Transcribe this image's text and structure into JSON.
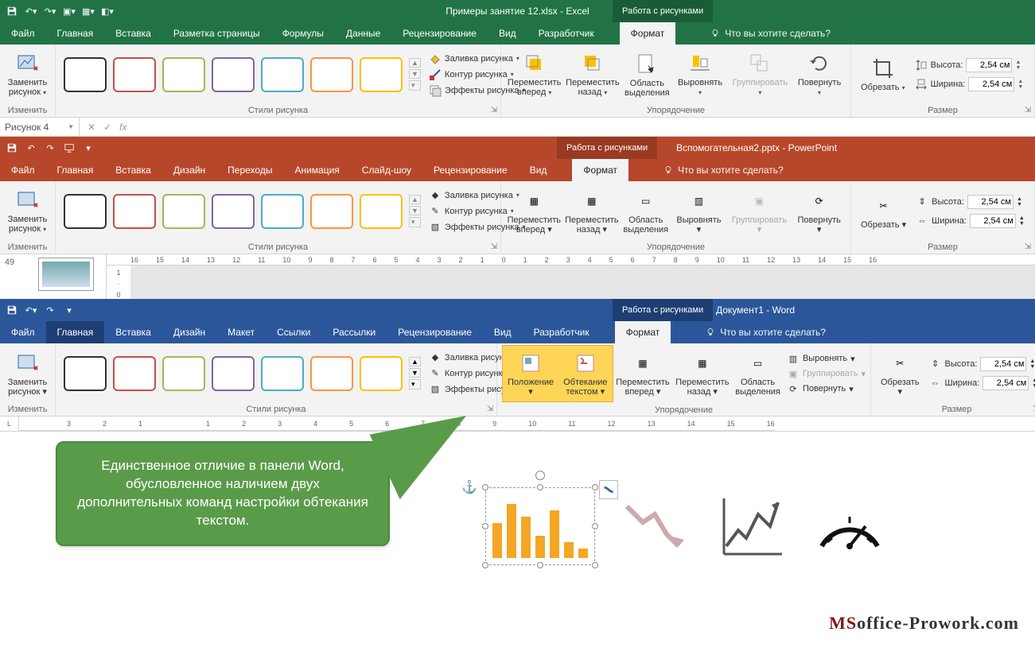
{
  "colors": {
    "excel": "#217346",
    "ppt": "#b7472a",
    "word": "#2b579a",
    "wordAccent": "#1e3e73"
  },
  "qat": {
    "save": "save-icon",
    "undo": "undo-icon",
    "redo": "redo-icon"
  },
  "excel": {
    "title": "Примеры занятие 12.xlsx  -  Excel",
    "ctxHeader": "Работа с рисунками",
    "tabs": [
      "Файл",
      "Главная",
      "Вставка",
      "Разметка страницы",
      "Формулы",
      "Данные",
      "Рецензирование",
      "Вид",
      "Разработчик"
    ],
    "activeTab": "Формат",
    "tellMe": "Что вы хотите сделать?",
    "nameBox": "Рисунок 4"
  },
  "ppt": {
    "title": "Вспомогательная2.pptx  -  PowerPoint",
    "ctxHeader": "Работа с рисунками",
    "tabs": [
      "Файл",
      "Главная",
      "Вставка",
      "Дизайн",
      "Переходы",
      "Анимация",
      "Слайд-шоу",
      "Рецензирование",
      "Вид"
    ],
    "activeTab": "Формат",
    "tellMe": "Что вы хотите сделать?",
    "slideNum": "49",
    "rulerTicks": [
      "16",
      "15",
      "14",
      "13",
      "12",
      "11",
      "10",
      "9",
      "8",
      "7",
      "6",
      "5",
      "4",
      "3",
      "2",
      "1",
      "0",
      "1",
      "2",
      "3",
      "4",
      "5",
      "6",
      "7",
      "8",
      "9",
      "10",
      "11",
      "12",
      "13",
      "14",
      "15",
      "16"
    ]
  },
  "word": {
    "title": "Документ1  -  Word",
    "ctxHeader": "Работа с рисунками",
    "tabs": [
      "Файл",
      "Главная",
      "Вставка",
      "Дизайн",
      "Макет",
      "Ссылки",
      "Рассылки",
      "Рецензирование",
      "Вид",
      "Разработчик"
    ],
    "activeTab": "Формат",
    "tellMe": "Что вы хотите сделать?",
    "rulerTicks": [
      "3",
      "2",
      "1",
      "",
      "1",
      "2",
      "3",
      "4",
      "5",
      "6",
      "7",
      "8",
      "9",
      "10",
      "11",
      "12",
      "13",
      "14",
      "15",
      "16"
    ]
  },
  "ribbonCommon": {
    "changeGroup": "Изменить",
    "replaceImg1": "Заменить",
    "replaceImg2": "рисунок",
    "stylesGroup": "Стили рисунка",
    "fill": "Заливка рисунка",
    "outline": "Контур рисунка",
    "effects": "Эффекты рисунка",
    "arrangeGroup": "Упорядочение",
    "bringFwd1": "Переместить",
    "bringFwd2": "вперед",
    "sendBack1": "Переместить",
    "sendBack2": "назад",
    "selPane1": "Область",
    "selPane2": "выделения",
    "align": "Выровнять",
    "group": "Группировать",
    "rotate": "Повернуть",
    "sizeGroup": "Размер",
    "crop": "Обрезать",
    "heightLbl": "Высота:",
    "widthLbl": "Ширина:",
    "heightVal": "2,54 см",
    "widthVal": "2,54 см"
  },
  "wordExtra": {
    "position": "Положение",
    "wrap1": "Обтекание",
    "wrap2": "текстом"
  },
  "callout": "Единственное отличие в панели Word, обусловленное наличием двух дополнительных команд настройки обтекания текстом.",
  "watermark": {
    "ms": "MS",
    "rest": "office-Prowork.com"
  }
}
